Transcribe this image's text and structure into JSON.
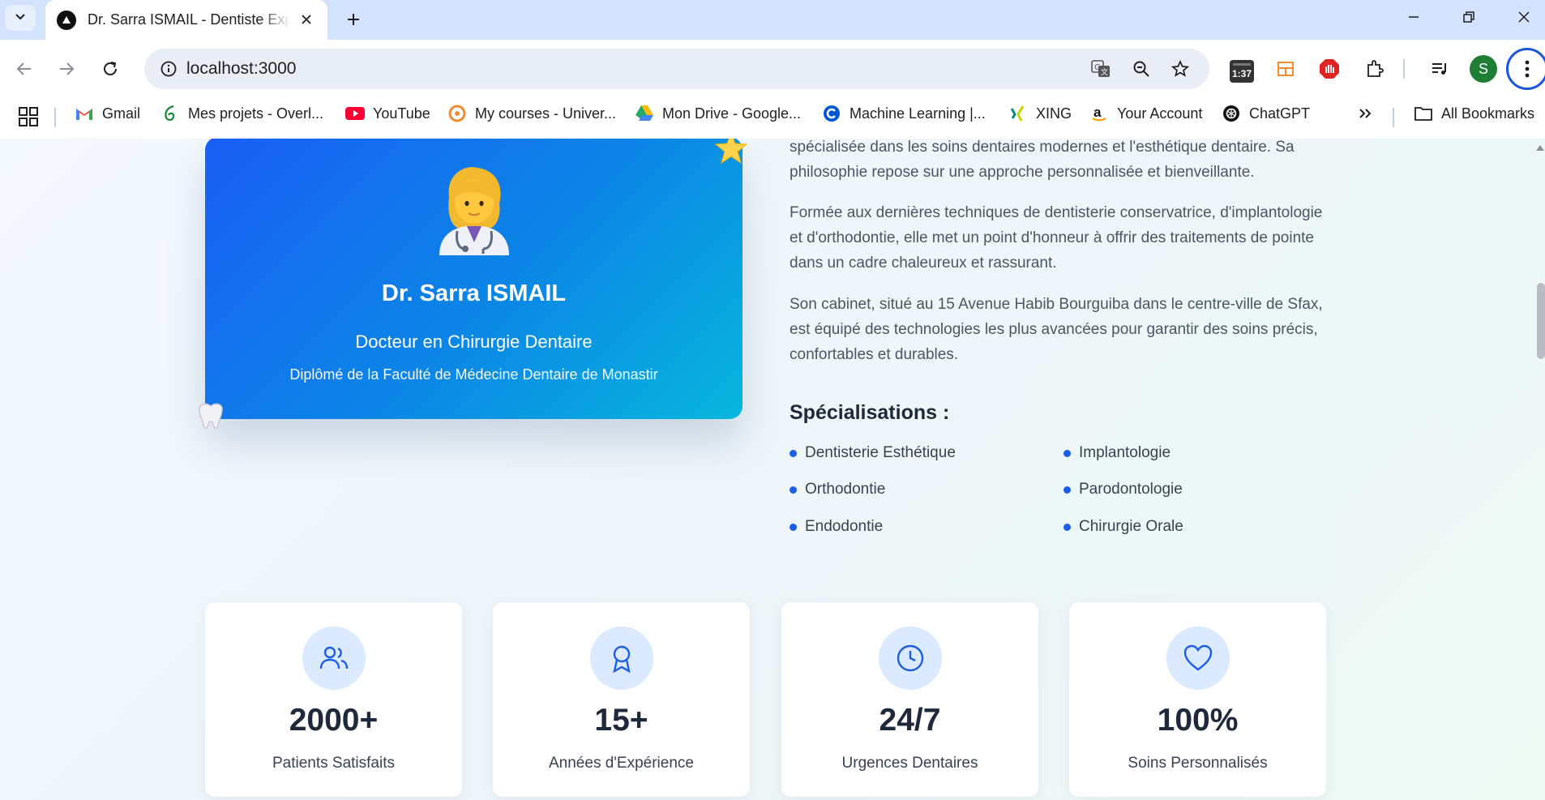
{
  "browser": {
    "tab_title": "Dr. Sarra ISMAIL - Dentiste Expert",
    "url": "localhost:3000",
    "timer_badge": "1:37",
    "profile_initial": "S",
    "bookmarks": [
      {
        "label": "Gmail",
        "icon": "gmail-icon"
      },
      {
        "label": "Mes projets - Overl...",
        "icon": "overleaf-icon"
      },
      {
        "label": "YouTube",
        "icon": "youtube-icon"
      },
      {
        "label": "My courses - Univer...",
        "icon": "moodle-icon"
      },
      {
        "label": "Mon Drive - Google...",
        "icon": "google-drive-icon"
      },
      {
        "label": "Machine Learning |...",
        "icon": "coursera-icon"
      },
      {
        "label": "XING",
        "icon": "xing-icon"
      },
      {
        "label": "Your Account",
        "icon": "amazon-icon"
      },
      {
        "label": "ChatGPT",
        "icon": "chatgpt-icon"
      }
    ],
    "all_bookmarks": "All Bookmarks"
  },
  "profile_card": {
    "name": "Dr. Sarra ISMAIL",
    "title": "Docteur en Chirurgie Dentaire",
    "diploma": "Diplômé de la Faculté de Médecine Dentaire de Monastir"
  },
  "about": {
    "paragraphs": [
      "spécialisée dans les soins dentaires modernes et l'esthétique dentaire. Sa philosophie repose sur une approche personnalisée et bienveillante.",
      "Formée aux dernières techniques de dentisterie conservatrice, d'implantologie et d'orthodontie, elle met un point d'honneur à offrir des traitements de pointe dans un cadre chaleureux et rassurant.",
      "Son cabinet, situé au 15 Avenue Habib Bourguiba dans le centre-ville de Sfax, est équipé des technologies les plus avancées pour garantir des soins précis, confortables et durables."
    ],
    "specialisations_title": "Spécialisations :",
    "specialisations": [
      "Dentisterie Esthétique",
      "Implantologie",
      "Orthodontie",
      "Parodontologie",
      "Endodontie",
      "Chirurgie Orale"
    ]
  },
  "stats": [
    {
      "value": "2000+",
      "label": "Patients Satisfaits",
      "icon": "users-icon"
    },
    {
      "value": "15+",
      "label": "Années d'Expérience",
      "icon": "award-icon"
    },
    {
      "value": "24/7",
      "label": "Urgences Dentaires",
      "icon": "clock-icon"
    },
    {
      "value": "100%",
      "label": "Soins Personnalisés",
      "icon": "heart-icon"
    }
  ],
  "colors": {
    "accent": "#1d5ee8",
    "card_gradient_start": "#1a5ef4",
    "card_gradient_end": "#07b7dc",
    "stat_icon_bg": "#dbeafe"
  }
}
